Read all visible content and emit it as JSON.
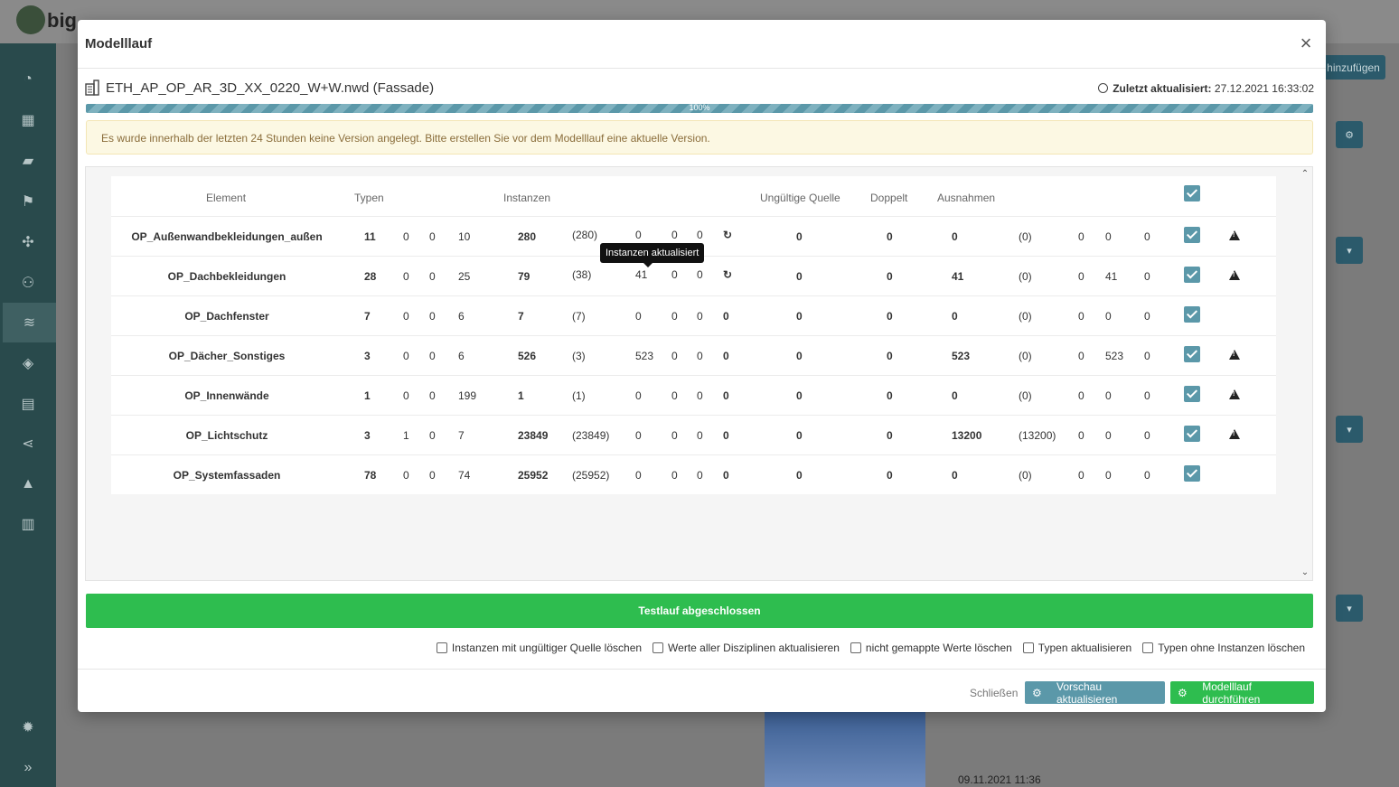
{
  "background": {
    "logo_text": "big",
    "add_button": "hinzufügen",
    "bottom_date": "09.11.2021 11:36"
  },
  "modal": {
    "title": "Modelllauf",
    "close_symbol": "×",
    "file_name": "ETH_AP_OP_AR_3D_XX_0220_W+W.nwd (Fassade)",
    "updated_label": "Zuletzt aktualisiert:",
    "updated_value": "27.12.2021 16:33:02",
    "progress_label": "100%",
    "progress_value": 100,
    "warning": "Es wurde innerhalb der letzten 24 Stunden keine Version angelegt. Bitte erstellen Sie vor dem Modelllauf eine aktuelle Version.",
    "tooltip": "Instanzen aktualisiert",
    "done_label": "Testlauf abgeschlossen",
    "options": [
      {
        "label": "Instanzen mit ungültiger Quelle löschen",
        "checked": false
      },
      {
        "label": "Werte aller Disziplinen aktualisieren",
        "checked": false
      },
      {
        "label": "nicht gemappte Werte löschen",
        "checked": false
      },
      {
        "label": "Typen aktualisieren",
        "checked": false
      },
      {
        "label": "Typen ohne Instanzen löschen",
        "checked": false
      }
    ],
    "close_button": "Schließen",
    "preview_button": "Vorschau aktualisieren",
    "run_button": "Modelllauf durchführen"
  },
  "table": {
    "headers": {
      "element": "Element",
      "types": "Typen",
      "instances": "Instanzen",
      "invalid_source": "Ungültige Quelle",
      "duplicate": "Doppelt",
      "exceptions": "Ausnahmen"
    },
    "rows": [
      {
        "element": "OP_Außenwandbekleidungen_außen",
        "types": "11",
        "t1": "0",
        "t2": "0",
        "t3": "10",
        "instances": "280",
        "paren": "(280)",
        "i1": "0",
        "i2": "0",
        "i3": "0",
        "i4": "↻",
        "invalid": "0",
        "dup": "0",
        "exc": "0",
        "exc_paren": "(0)",
        "e1": "0",
        "e2": "0",
        "e3": "0",
        "warn": true
      },
      {
        "element": "OP_Dachbekleidungen",
        "types": "28",
        "t1": "0",
        "t2": "0",
        "t3": "25",
        "instances": "79",
        "paren": "(38)",
        "i1": "41",
        "i2": "0",
        "i3": "0",
        "i4": "↻",
        "invalid": "0",
        "dup": "0",
        "exc": "41",
        "exc_paren": "(0)",
        "e1": "0",
        "e2": "41",
        "e3": "0",
        "warn": true
      },
      {
        "element": "OP_Dachfenster",
        "types": "7",
        "t1": "0",
        "t2": "0",
        "t3": "6",
        "instances": "7",
        "paren": "(7)",
        "i1": "0",
        "i2": "0",
        "i3": "0",
        "i4": "0",
        "invalid": "0",
        "dup": "0",
        "exc": "0",
        "exc_paren": "(0)",
        "e1": "0",
        "e2": "0",
        "e3": "0",
        "warn": false
      },
      {
        "element": "OP_Dächer_Sonstiges",
        "types": "3",
        "t1": "0",
        "t2": "0",
        "t3": "6",
        "instances": "526",
        "paren": "(3)",
        "i1": "523",
        "i2": "0",
        "i3": "0",
        "i4": "0",
        "invalid": "0",
        "dup": "0",
        "exc": "523",
        "exc_paren": "(0)",
        "e1": "0",
        "e2": "523",
        "e3": "0",
        "warn": true
      },
      {
        "element": "OP_Innenwände",
        "types": "1",
        "t1": "0",
        "t2": "0",
        "t3": "199",
        "instances": "1",
        "paren": "(1)",
        "i1": "0",
        "i2": "0",
        "i3": "0",
        "i4": "0",
        "invalid": "0",
        "dup": "0",
        "exc": "0",
        "exc_paren": "(0)",
        "e1": "0",
        "e2": "0",
        "e3": "0",
        "warn": true
      },
      {
        "element": "OP_Lichtschutz",
        "types": "3",
        "t1": "1",
        "t2": "0",
        "t3": "7",
        "instances": "23849",
        "paren": "(23849)",
        "i1": "0",
        "i2": "0",
        "i3": "0",
        "i4": "0",
        "invalid": "0",
        "dup": "0",
        "exc": "13200",
        "exc_paren": "(13200)",
        "e1": "0",
        "e2": "0",
        "e3": "0",
        "warn": true
      },
      {
        "element": "OP_Systemfassaden",
        "types": "78",
        "t1": "0",
        "t2": "0",
        "t3": "74",
        "instances": "25952",
        "paren": "(25952)",
        "i1": "0",
        "i2": "0",
        "i3": "0",
        "i4": "0",
        "invalid": "0",
        "dup": "0",
        "exc": "0",
        "exc_paren": "(0)",
        "e1": "0",
        "e2": "0",
        "e3": "0",
        "warn": false
      }
    ]
  },
  "colors": {
    "accent": "#5b98a9",
    "success": "#2ebd4f",
    "warning_bg": "#fcf8e3",
    "warning_text": "#8a6d3b",
    "sidebar": "#294a4c"
  },
  "icons": {
    "sidebar": [
      "dashboard-icon",
      "grid-icon",
      "book-icon",
      "flag-icon",
      "puzzle-icon",
      "users-icon",
      "database-icon",
      "layers-icon",
      "table-icon",
      "share-icon",
      "alert-icon",
      "server-icon",
      "settings-icon",
      "expand-icon"
    ]
  }
}
